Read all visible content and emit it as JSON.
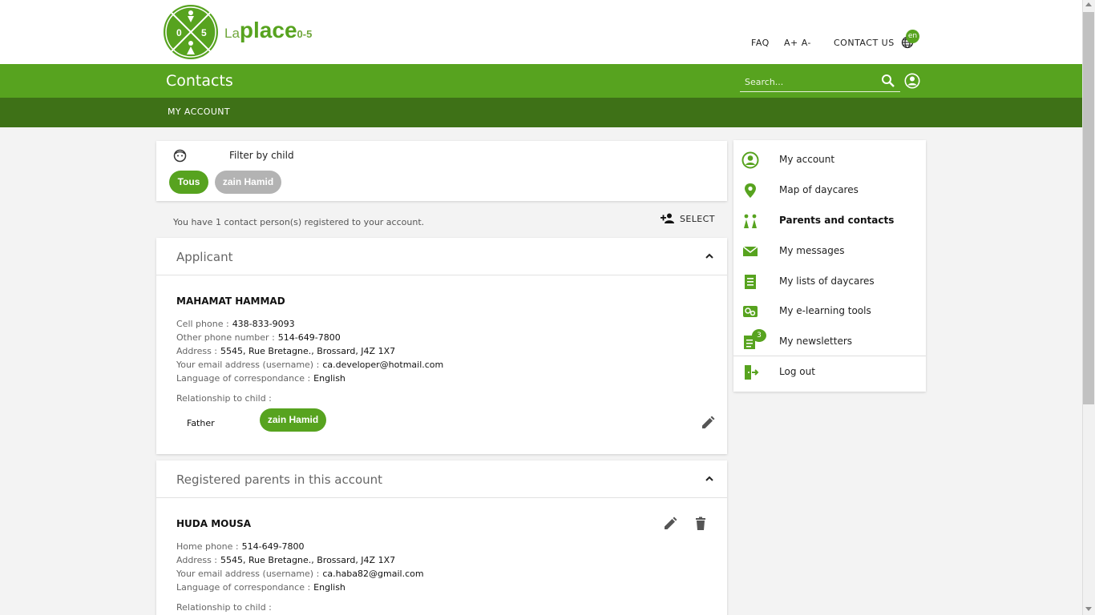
{
  "brand": {
    "la": "La",
    "place": "place",
    "age": "0-5"
  },
  "top_links": {
    "faq": "FAQ",
    "font_size": "A+ A-",
    "contact": "CONTACT US",
    "language": "en"
  },
  "header": {
    "title": "Contacts",
    "search_placeholder": "Search..."
  },
  "subnav": {
    "my_account": "MY ACCOUNT"
  },
  "filter": {
    "label": "Filter by child",
    "chips": [
      "Tous",
      "zain Hamid"
    ]
  },
  "contacts_summary": {
    "text": "You have 1 contact person(s) registered to your account.",
    "select_label": "SELECT"
  },
  "applicant": {
    "section_title": "Applicant",
    "name": "MAHAMAT HAMMAD",
    "cell_label": "Cell phone :",
    "cell_value": "438-833-9093",
    "other_label": "Other phone number :",
    "other_value": "514-649-7800",
    "address_label": "Address :",
    "address_value": "5545, Rue Bretagne., Brossard, J4Z 1X7",
    "email_label": "Your email address (username) :",
    "email_value": "ca.developer@hotmail.com",
    "lang_label": "Language of correspondance :",
    "lang_value": "English",
    "relationship_label": "Relationship to child :",
    "relationship": "Father",
    "child": "zain Hamid"
  },
  "registered_parents": {
    "section_title": "Registered parents in this account",
    "name": "HUDA MOUSA",
    "home_label": "Home phone :",
    "home_value": "514-649-7800",
    "address_label": "Address :",
    "address_value": "5545, Rue Bretagne., Brossard, J4Z 1X7",
    "email_label": "Your email address (username) :",
    "email_value": "ca.haba82@gmail.com",
    "lang_label": "Language of correspondance :",
    "lang_value": "English",
    "relationship_label": "Relationship to child :"
  },
  "side_menu": {
    "items": [
      {
        "label": "My account",
        "icon": "account-circle-icon"
      },
      {
        "label": "Map of daycares",
        "icon": "map-pin-icon"
      },
      {
        "label": "Parents and contacts",
        "icon": "family-icon"
      },
      {
        "label": "My messages",
        "icon": "envelope-icon"
      },
      {
        "label": "My lists of daycares",
        "icon": "list-icon"
      },
      {
        "label": "My e-learning tools",
        "icon": "elearning-icon"
      },
      {
        "label": "My newsletters",
        "icon": "newsletter-icon"
      },
      {
        "label": "Log out",
        "icon": "logout-icon"
      }
    ],
    "newsletter_count": "3"
  },
  "colors": {
    "brand_green": "#57a31f",
    "dark_green": "#3e7117",
    "chip_grey": "#b3b3b3"
  }
}
